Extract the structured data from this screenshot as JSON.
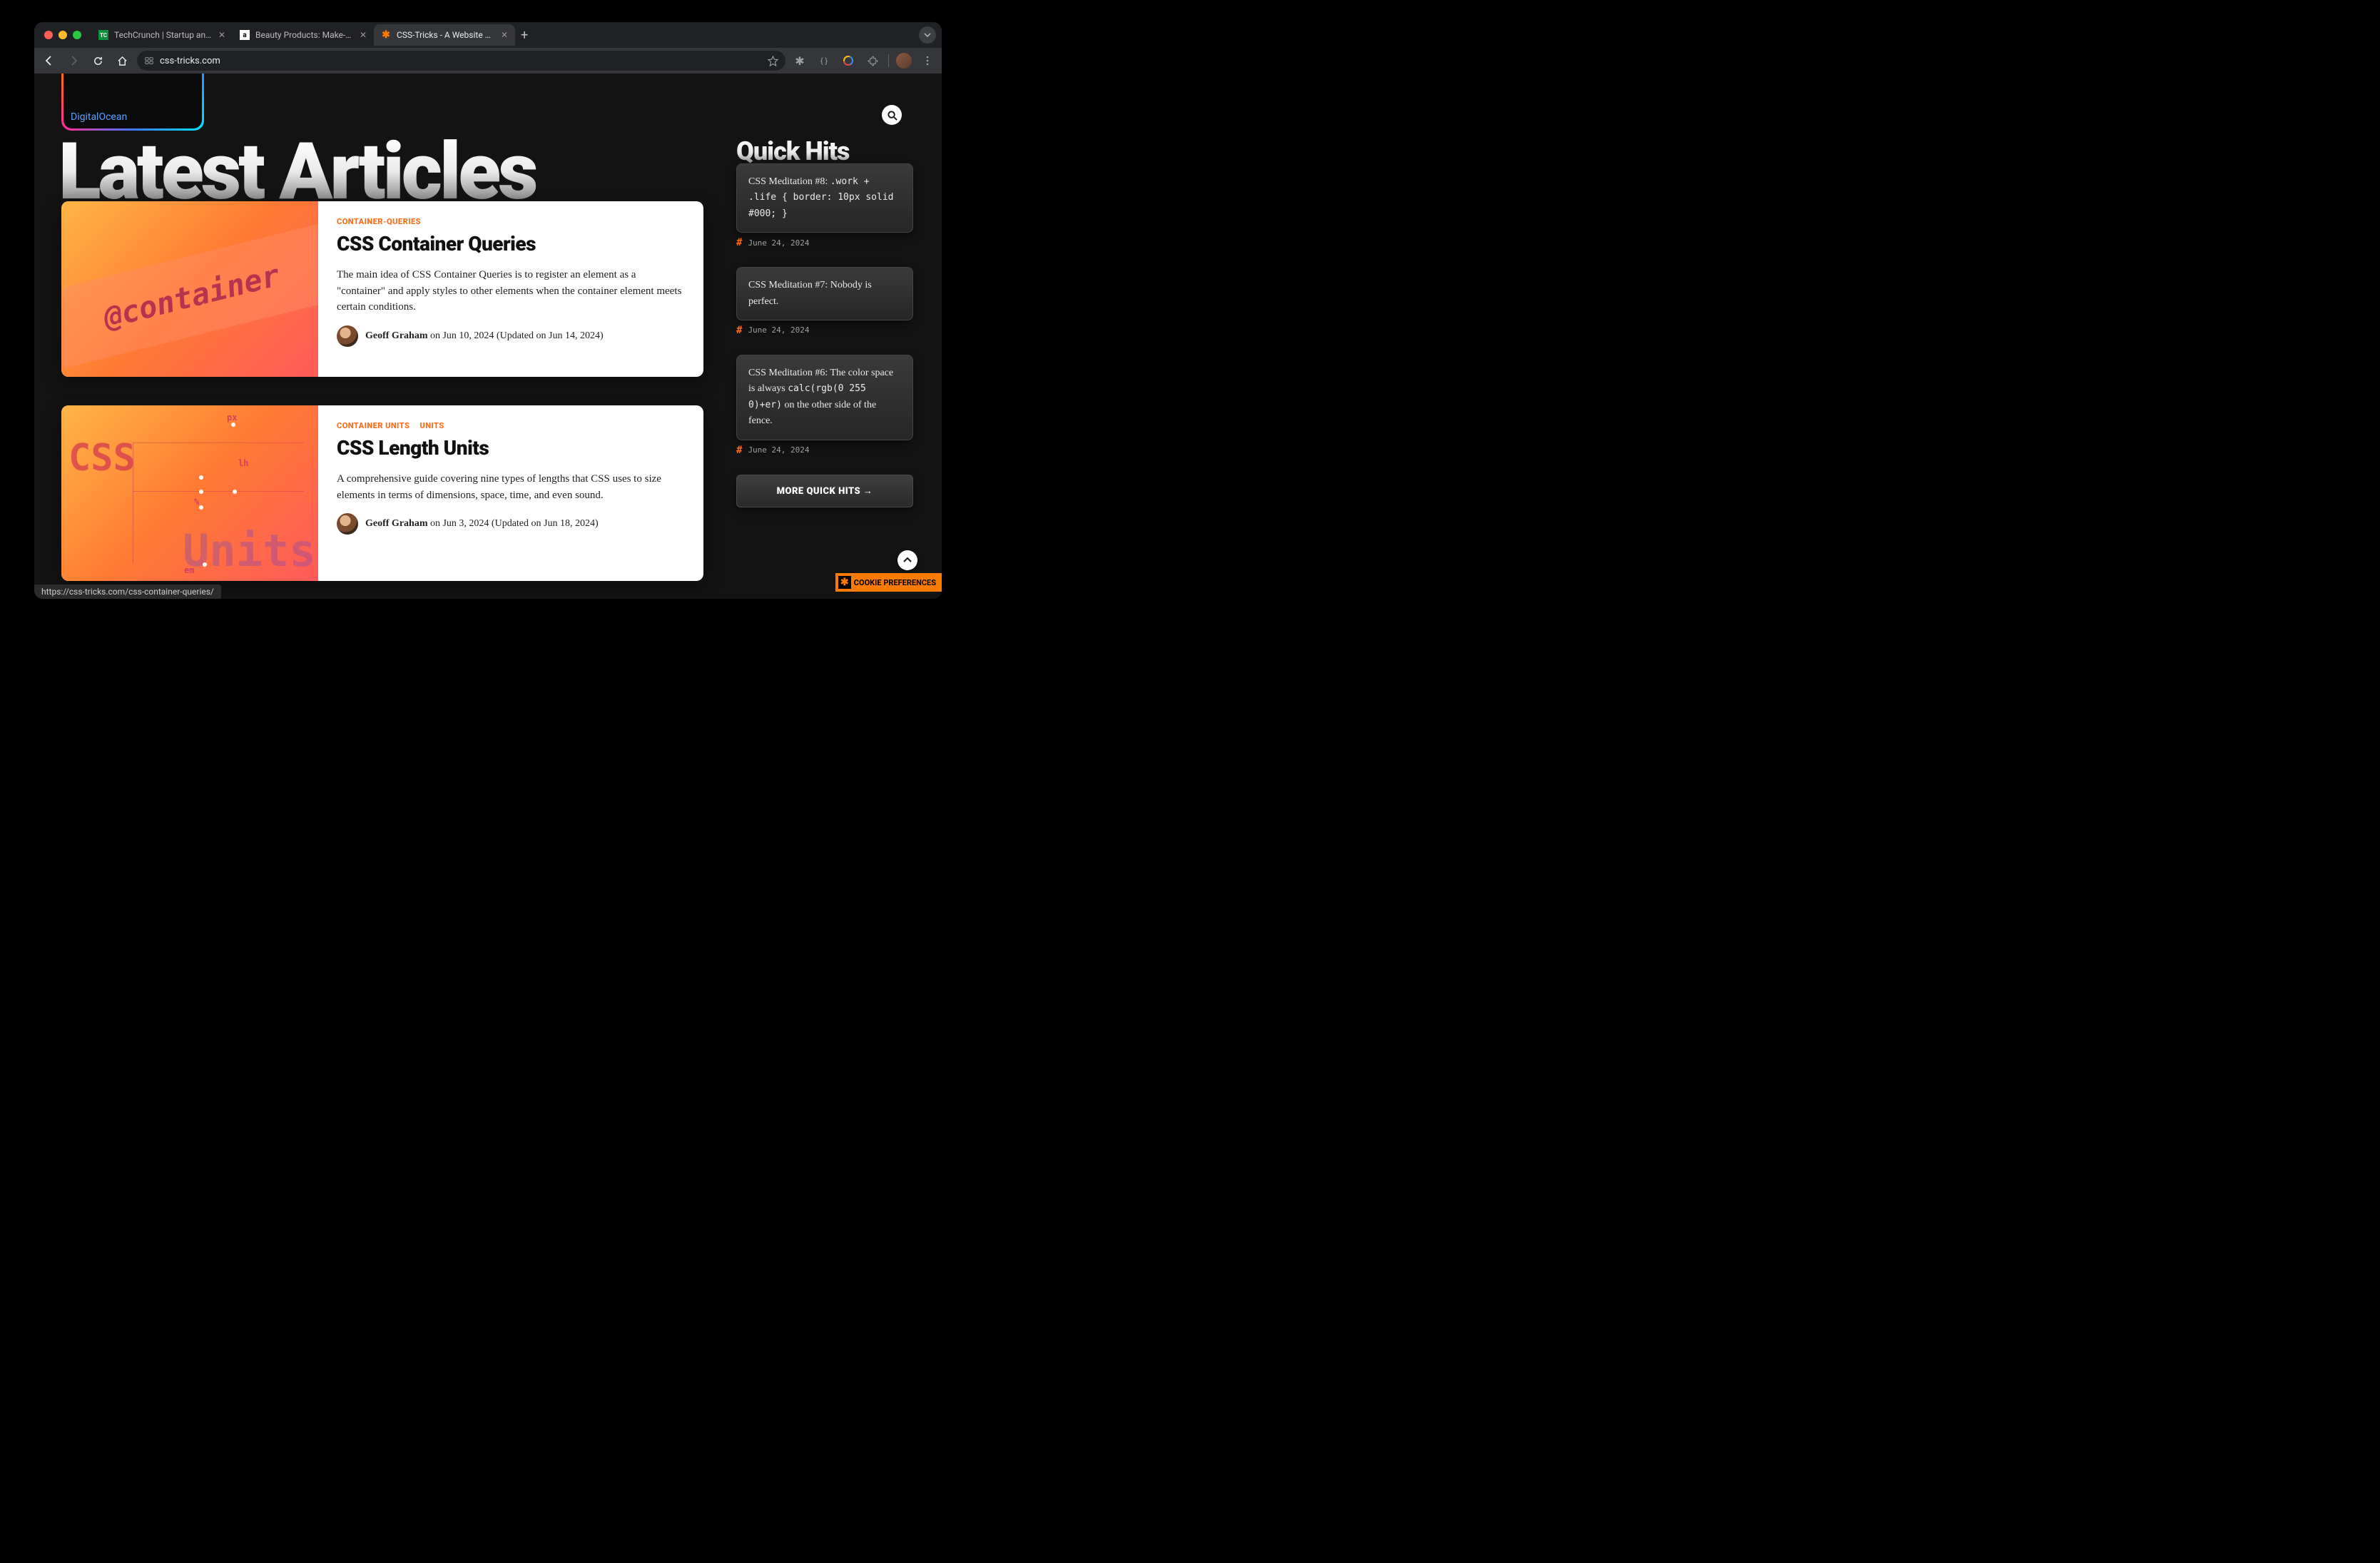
{
  "browser": {
    "tabs": [
      {
        "title": "TechCrunch | Startup and Tec"
      },
      {
        "title": "Beauty Products: Make-up"
      },
      {
        "title": "CSS-Tricks - A Website Abou"
      }
    ],
    "url": "css-tricks.com",
    "status_url": "https://css-tricks.com/css-container-queries/"
  },
  "page": {
    "logo_sub": "DigitalOcean",
    "heading": "Latest Articles",
    "articles": [
      {
        "tags": [
          "CONTAINER-QUERIES"
        ],
        "title": "CSS Container Queries",
        "desc": "The main idea of CSS Container Queries is to register an element as a \"container\" and apply styles to other elements when the container element meets certain conditions.",
        "author": "Geoff Graham",
        "date": "on Jun 10, 2024 (Updated on Jun 14, 2024)",
        "thumb_text": "@container"
      },
      {
        "tags": [
          "CONTAINER UNITS",
          "UNITS"
        ],
        "title": "CSS Length Units",
        "desc": "A comprehensive guide covering nine types of lengths that CSS uses to size elements in terms of dimensions, space, time, and even sound.",
        "author": "Geoff Graham",
        "date": "on Jun 3, 2024 (Updated on Jun 18, 2024)",
        "thumb_css": "CSS",
        "thumb_units": "Units",
        "ann_px": "px",
        "ann_lh": "lh",
        "ann_pct": "%",
        "ann_em": "em"
      }
    ],
    "sidebar": {
      "heading": "Quick Hits",
      "hits": [
        {
          "prefix": "CSS Meditation #8: ",
          "code": ".work + .life { border: 10px solid #000; }",
          "date": "June 24, 2024"
        },
        {
          "text": "CSS Meditation #7: Nobody is perfect.",
          "date": "June 24, 2024"
        },
        {
          "prefix": "CSS Meditation #6: The color space is always ",
          "code": "calc(rgb(0 255 0)+er)",
          "suffix": " on the other side of the fence.",
          "date": "June 24, 2024"
        }
      ],
      "more": "MORE QUICK HITS →"
    },
    "cookie": "COOKIE PREFERENCES"
  }
}
